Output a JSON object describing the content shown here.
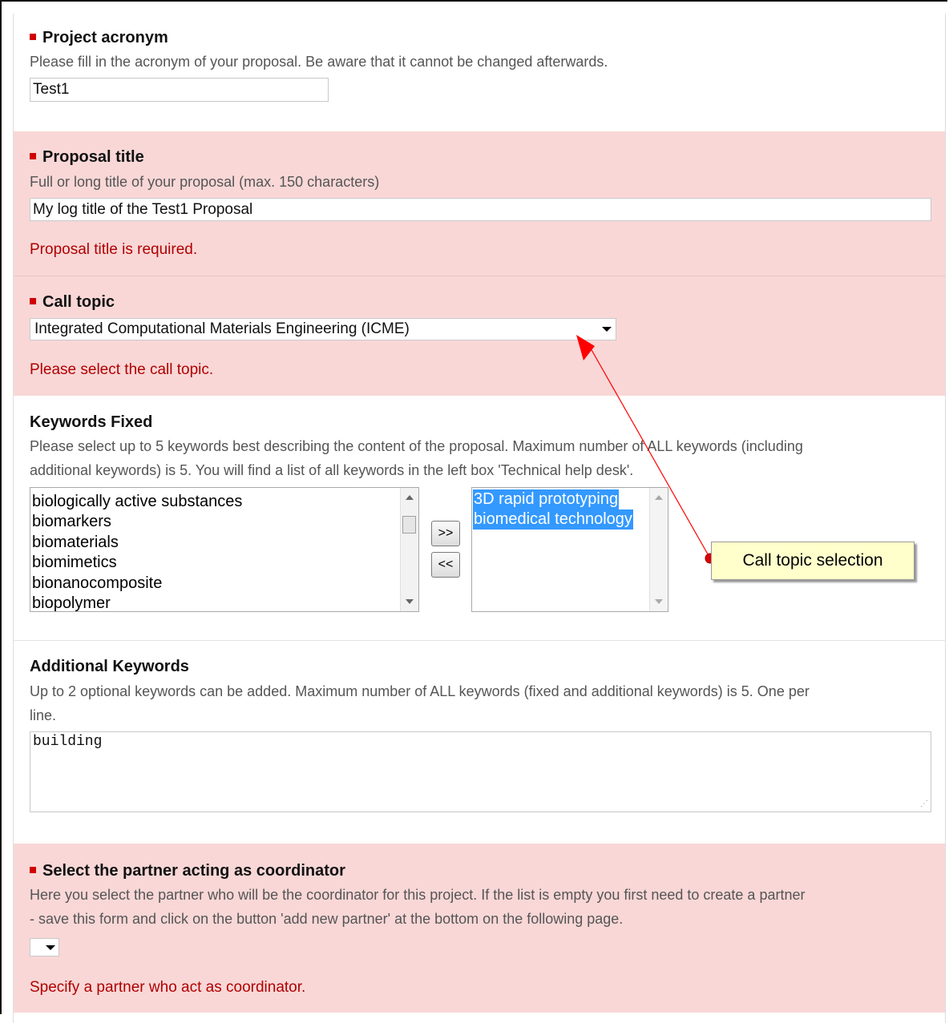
{
  "acronym": {
    "title": "Project acronym",
    "description": "Please fill in the acronym of your proposal. Be aware that it cannot be changed afterwards.",
    "value": "Test1"
  },
  "proposal_title": {
    "title": "Proposal title",
    "description": "Full or long title of your proposal (max. 150 characters)",
    "value": "My log title of the Test1 Proposal",
    "error": "Proposal title is required."
  },
  "call_topic": {
    "title": "Call topic",
    "selected": "Integrated Computational Materials Engineering (ICME)",
    "error": "Please select the call topic."
  },
  "keywords_fixed": {
    "title": "Keywords Fixed",
    "description_line1": "Please select up to 5 keywords best describing the content of the proposal. Maximum number of ALL keywords (including",
    "description_line2": "additional keywords) is 5. You will find a list of all keywords in the left box 'Technical help desk'.",
    "available": [
      "biologically active substances",
      "biomarkers",
      "biomaterials",
      "biomimetics",
      "bionanocomposite",
      "biopolymer"
    ],
    "selected": [
      "3D rapid prototyping",
      "biomedical technology"
    ],
    "add_label": ">>",
    "remove_label": "<<"
  },
  "additional_keywords": {
    "title": "Additional Keywords",
    "description_line1": "Up to 2 optional keywords can be added. Maximum number of ALL keywords (fixed and additional keywords) is 5. One per",
    "description_line2": "line.",
    "value": "building"
  },
  "coordinator": {
    "title": "Select the partner acting as coordinator",
    "description_line1": "Here you select the partner who will be the coordinator for this project. If the list is empty you first need to create a partner",
    "description_line2": "- save this form and click on the button 'add new partner' at the bottom on the following page.",
    "selected": "",
    "error": "Specify a partner who act as coordinator."
  },
  "annotation": {
    "label": "Call topic selection",
    "color": "#ff0000"
  },
  "colors": {
    "error_bg": "#f9d7d7",
    "error_text": "#b00000",
    "required_marker": "#d00000",
    "selection": "#3399ff"
  }
}
